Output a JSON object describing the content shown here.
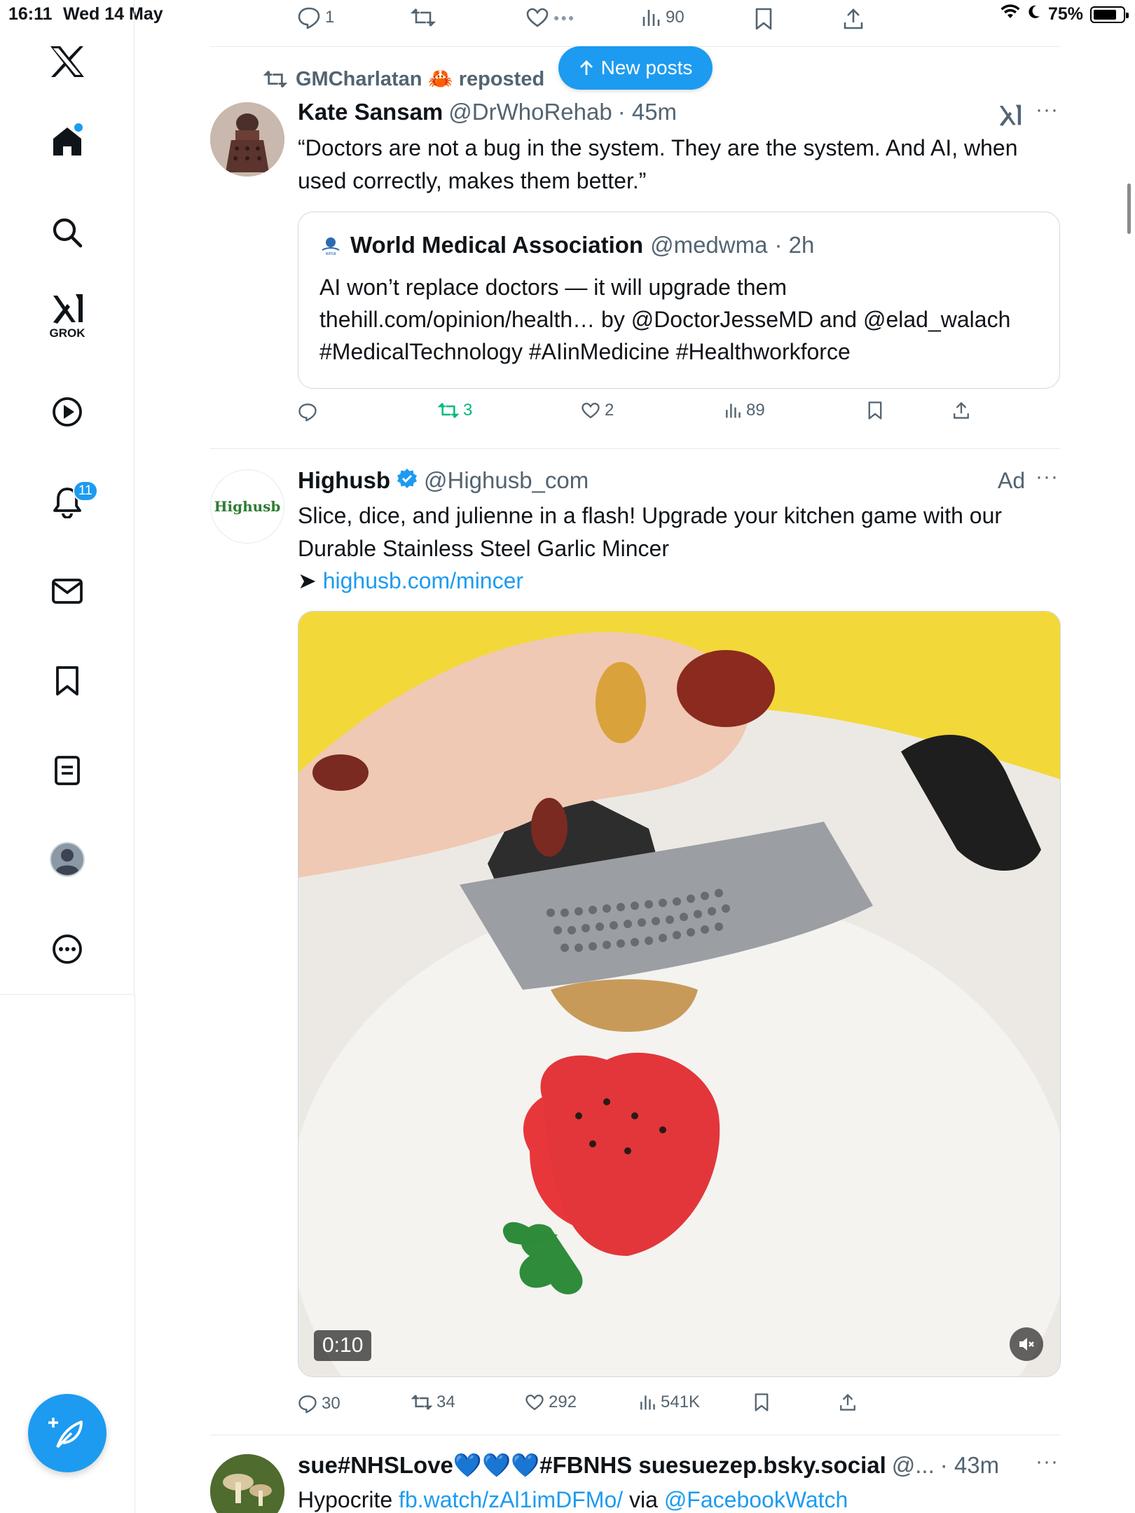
{
  "status_bar": {
    "time": "16:11",
    "date": "Wed 14 May",
    "battery": "75%",
    "battery_level": 0.75
  },
  "sidebar": {
    "grok_label": "GROK",
    "notification_count": "11",
    "icons": [
      "x-logo-icon",
      "home-icon",
      "search-icon",
      "grok-icon",
      "video-icon",
      "notifications-icon",
      "messages-icon",
      "bookmarks-icon",
      "lists-icon",
      "profile-icon",
      "more-icon"
    ]
  },
  "top_tweet_actions": {
    "replies": "1",
    "views": "90"
  },
  "new_posts_label": "New posts",
  "tweet1": {
    "repost_by": "GMCharlatan 🦀 reposted",
    "name": "Kate Sansam",
    "handle": "@DrWhoRehab",
    "time": "· 45m",
    "text": "“Doctors are not a bug in the system. They are the system. And AI, when used correctly, makes them better.”",
    "quote": {
      "name": "World Medical Association",
      "handle": "@medwma",
      "time": "· 2h",
      "text": "AI won’t replace doctors — it will upgrade them thehill.com/opinion/health… by @DoctorJesseMD and @elad_walach #MedicalTechnology #AIinMedicine #Healthworkforce"
    },
    "actions": {
      "reposts": "3",
      "likes": "2",
      "views": "89"
    }
  },
  "tweet2": {
    "avatar_text": "Highusb",
    "name": "Highusb",
    "handle": "@Highusb_com",
    "ad_label": "Ad",
    "text": "Slice, dice, and julienne in a flash! Upgrade your kitchen game with our Durable Stainless Steel Garlic Mincer",
    "arrow": "➤",
    "link": "highusb.com/mincer",
    "video_duration": "0:10",
    "actions": {
      "replies": "30",
      "reposts": "34",
      "likes": "292",
      "views": "541K"
    }
  },
  "tweet3": {
    "name": "sue#NHSLove💙💙💙#FBNHS suesuezep.bsky.social",
    "handle": "@...",
    "time": "· 43m",
    "text_prefix": "Hypocrite",
    "link1": "fb.watch/zAl1imDFMo/",
    "text_mid": "via",
    "link2": "@FacebookWatch"
  },
  "colors": {
    "accent": "#1d9bf0",
    "repost_green": "#00ba7c",
    "text": "#0f1419",
    "muted": "#536471"
  }
}
